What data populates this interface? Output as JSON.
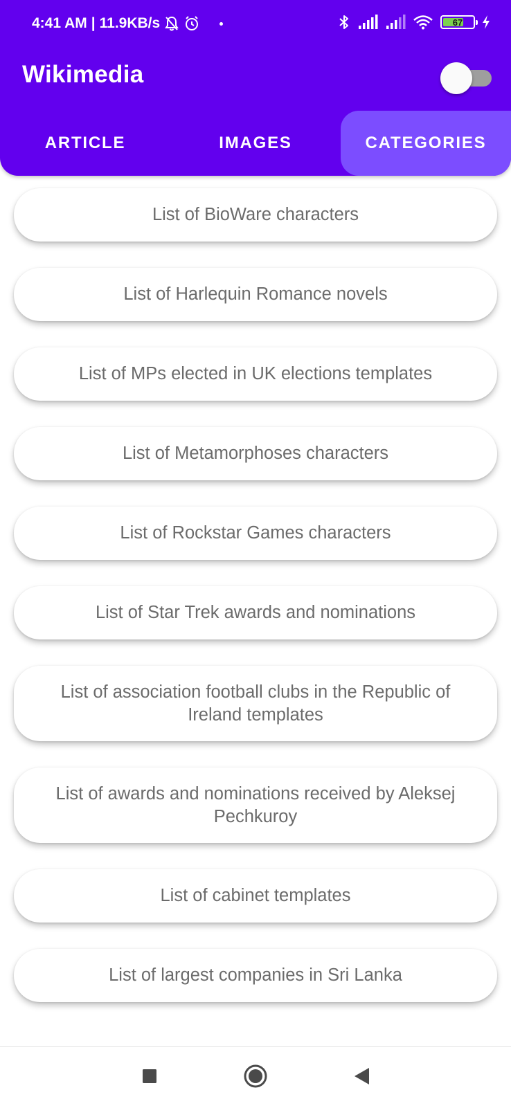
{
  "status_bar": {
    "time": "4:41 AM",
    "separator": "|",
    "speed": "11.9KB/s",
    "battery_level": "67",
    "icons": [
      "notifications-off-icon",
      "alarm-icon",
      "bluetooth-icon",
      "signal-icon",
      "signal-icon",
      "wifi-icon",
      "battery-icon",
      "charging-icon"
    ]
  },
  "app_bar": {
    "title": "Wikimedia",
    "toggle_on": false
  },
  "tabs": [
    {
      "label": "ARTICLE",
      "active": false
    },
    {
      "label": "IMAGES",
      "active": false
    },
    {
      "label": "CATEGORIES",
      "active": true
    }
  ],
  "categories": [
    "List of BioWare characters",
    "List of Harlequin Romance novels",
    "List of MPs elected in UK elections templates",
    "List of Metamorphoses characters",
    "List of Rockstar Games characters",
    "List of Star Trek awards and nominations",
    "List of association football clubs in the Republic of Ireland templates",
    "List of awards and nominations received by Aleksej Pechkuroy",
    "List of cabinet templates",
    "List of largest companies in Sri Lanka"
  ],
  "navigation": [
    "recents-square-icon",
    "home-circle-icon",
    "back-triangle-icon"
  ],
  "colors": {
    "primary": "#6200EE",
    "tab_active": "#7C4DFF",
    "card_text": "#6B6B6B",
    "battery_fill": "#7CD14F"
  }
}
